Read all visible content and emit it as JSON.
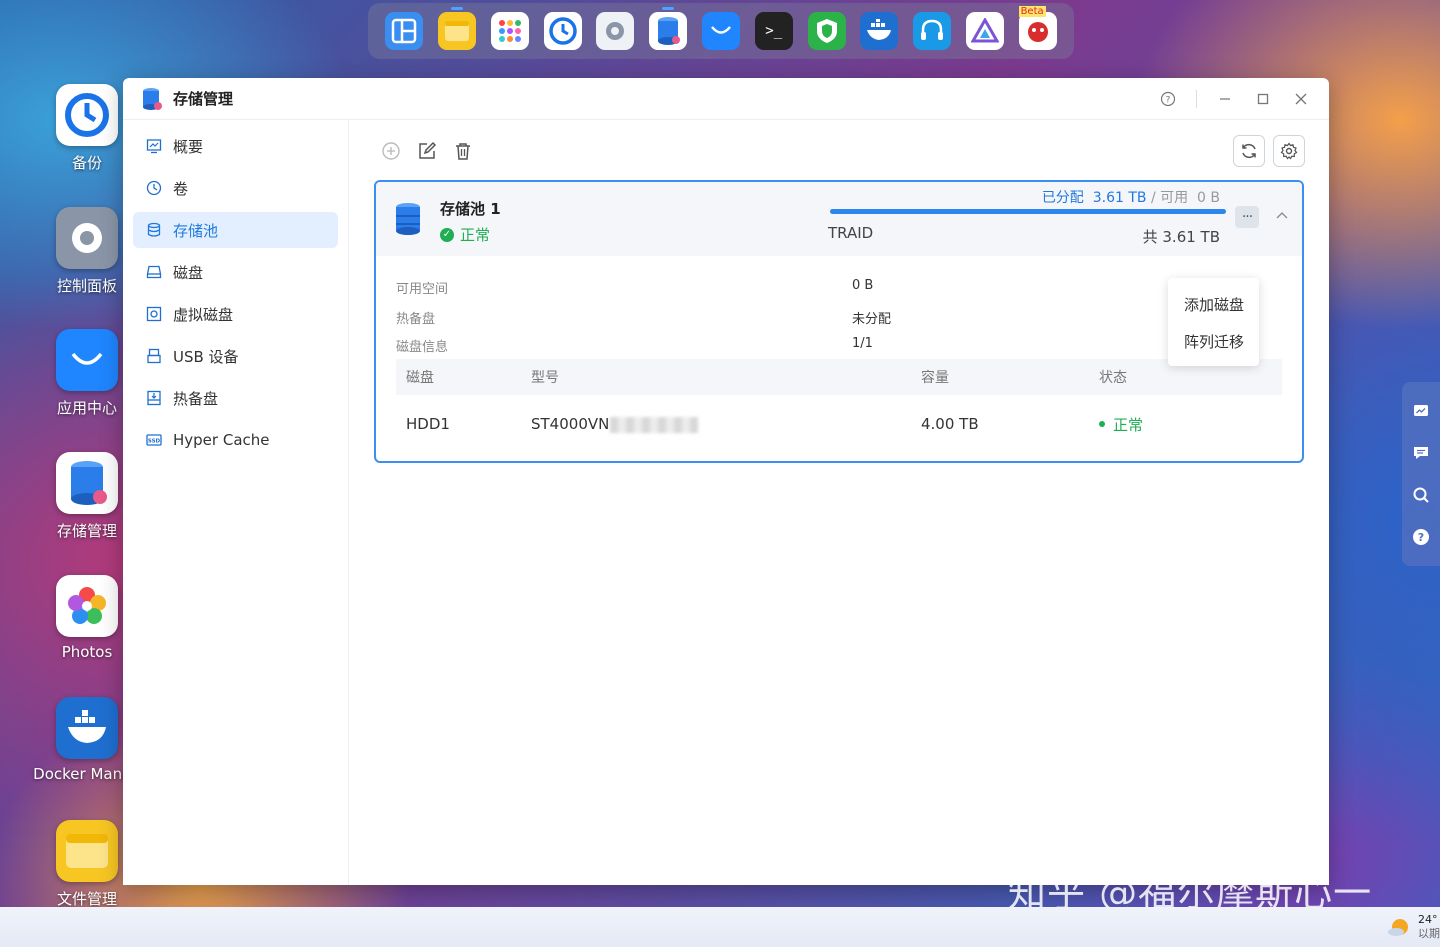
{
  "dock": {
    "items": [
      {
        "name": "window-manager",
        "color": "#3a8ef0"
      },
      {
        "name": "notes",
        "color": "#f7c623"
      },
      {
        "name": "app-grid",
        "color": "#ffffff"
      },
      {
        "name": "backup",
        "color": "#1a73e8"
      },
      {
        "name": "control-panel",
        "color": "#8a96a8"
      },
      {
        "name": "storage-manager",
        "color": "#2b7de9"
      },
      {
        "name": "app-center",
        "color": "#1f86ff"
      },
      {
        "name": "terminal",
        "color": "#222222"
      },
      {
        "name": "security",
        "color": "#2bb34a"
      },
      {
        "name": "docker",
        "color": "#1f6fd1"
      },
      {
        "name": "support",
        "color": "#1a9ae6"
      },
      {
        "name": "jellyfin",
        "color": "#7a55d8"
      },
      {
        "name": "beta-app",
        "color": "#d92c2c",
        "badge": "Beta"
      }
    ]
  },
  "desktop": {
    "icons": [
      {
        "label": "备份",
        "icon": "backup-icon"
      },
      {
        "label": "控制面板",
        "icon": "control-panel-icon"
      },
      {
        "label": "应用中心",
        "icon": "app-center-icon"
      },
      {
        "label": "存储管理",
        "icon": "storage-icon"
      },
      {
        "label": "Photos",
        "icon": "photos-icon"
      },
      {
        "label": "Docker Manag",
        "icon": "docker-icon"
      },
      {
        "label": "文件管理",
        "icon": "file-manager-icon"
      }
    ]
  },
  "window": {
    "title": "存储管理",
    "accent": "#1f7ae0"
  },
  "sidebar": {
    "items": [
      {
        "label": "概要",
        "icon": "overview-icon"
      },
      {
        "label": "卷",
        "icon": "volume-icon"
      },
      {
        "label": "存储池",
        "icon": "storage-pool-icon",
        "active": true
      },
      {
        "label": "磁盘",
        "icon": "disk-icon"
      },
      {
        "label": "虚拟磁盘",
        "icon": "virtual-disk-icon"
      },
      {
        "label": "USB 设备",
        "icon": "usb-icon"
      },
      {
        "label": "热备盘",
        "icon": "hot-spare-icon"
      },
      {
        "label": "Hyper Cache",
        "icon": "ssd-cache-icon"
      }
    ]
  },
  "pool": {
    "name": "存储池 1",
    "status": "正常",
    "raid_type": "TRAID",
    "allocated_label": "已分配",
    "allocated_value": "3.61 TB",
    "separator": "/",
    "available_label": "可用",
    "available_value": "0 B",
    "total": "共 3.61 TB",
    "usage_fraction": 1.0,
    "status_color": "#1fae52",
    "details": [
      {
        "key": "可用空间",
        "value": "0 B"
      },
      {
        "key": "热备盘",
        "value": "未分配"
      },
      {
        "key": "磁盘信息",
        "value": "1/1"
      }
    ],
    "table": {
      "headers": [
        "磁盘",
        "型号",
        "容量",
        "状态"
      ],
      "rows": [
        {
          "disk": "HDD1",
          "model": "ST4000VN",
          "capacity": "4.00 TB",
          "status": "正常"
        }
      ]
    }
  },
  "menu": {
    "items": [
      "添加磁盘",
      "阵列迁移"
    ]
  },
  "watermark": "知乎 @福尔摩斯心一",
  "taskbar": {
    "temperature": "24°",
    "weather_line2": "以期"
  }
}
